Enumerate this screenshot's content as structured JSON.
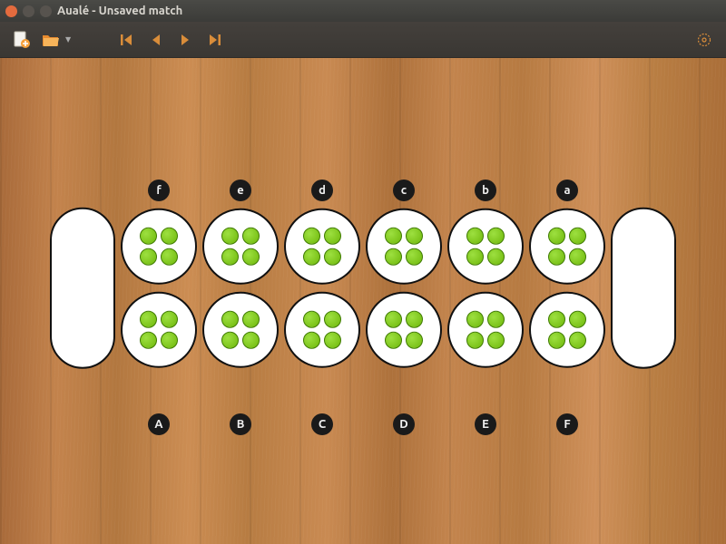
{
  "window": {
    "title": "Aualé - Unsaved match"
  },
  "toolbar": {
    "new_match": "New match",
    "open_match": "Open match",
    "nav_first": "First move",
    "nav_prev": "Previous move",
    "nav_next": "Next move",
    "nav_last": "Last move",
    "settings": "Settings"
  },
  "board": {
    "top_labels": [
      "f",
      "e",
      "d",
      "c",
      "b",
      "a"
    ],
    "bottom_labels": [
      "A",
      "B",
      "C",
      "D",
      "E",
      "F"
    ],
    "top_pits": [
      4,
      4,
      4,
      4,
      4,
      4
    ],
    "bottom_pits": [
      4,
      4,
      4,
      4,
      4,
      4
    ],
    "left_store": 0,
    "right_store": 0
  },
  "colors": {
    "seed": "#7cc20e",
    "toolbar_accent": "#d98d3a"
  }
}
